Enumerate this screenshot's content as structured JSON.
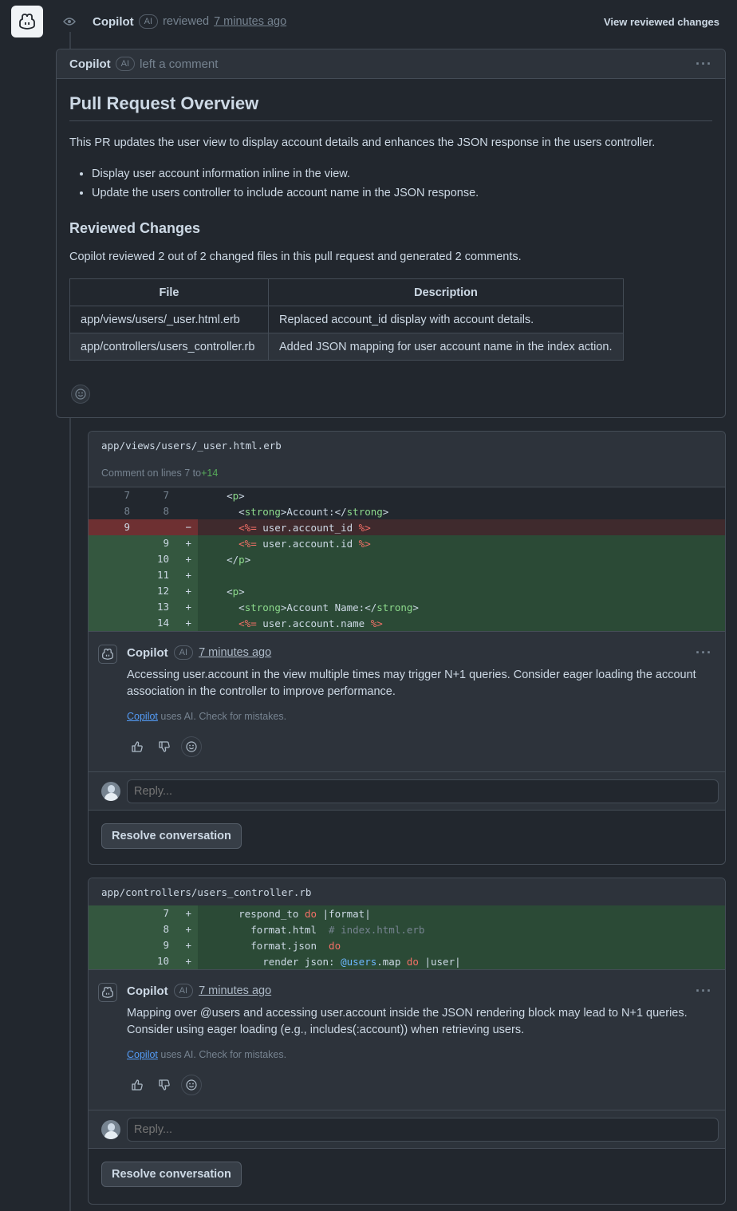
{
  "event": {
    "author": "Copilot",
    "badge": "AI",
    "action": "reviewed",
    "time": "7 minutes ago",
    "view_changes": "View reviewed changes"
  },
  "review": {
    "author": "Copilot",
    "badge": "AI",
    "action": "left a comment",
    "heading": "Pull Request Overview",
    "intro": "This PR updates the user view to display account details and enhances the JSON response in the users controller.",
    "bullets": [
      "Display user account information inline in the view.",
      "Update the users controller to include account name in the JSON response."
    ],
    "subheading": "Reviewed Changes",
    "summary": "Copilot reviewed 2 out of 2 changed files in this pull request and generated 2 comments.",
    "table": {
      "headers": [
        "File",
        "Description"
      ],
      "rows": [
        [
          "app/views/users/_user.html.erb",
          "Replaced account_id display with account details."
        ],
        [
          "app/controllers/users_controller.rb",
          "Added JSON mapping for user account name in the index action."
        ]
      ]
    }
  },
  "thread1": {
    "file": "app/views/users/_user.html.erb",
    "comment_on_prefix": "Comment on lines 7 to ",
    "comment_on_range": "+14",
    "comment": {
      "author": "Copilot",
      "badge": "AI",
      "time": "7 minutes ago",
      "text": "Accessing user.account in the view multiple times may trigger N+1 queries. Consider eager loading the account association in the controller to improve performance.",
      "disclaimer_link": "Copilot",
      "disclaimer_rest": " uses AI. Check for mistakes."
    },
    "reply_placeholder": "Reply...",
    "resolve": "Resolve conversation"
  },
  "thread2": {
    "file": "app/controllers/users_controller.rb",
    "comment": {
      "author": "Copilot",
      "badge": "AI",
      "time": "7 minutes ago",
      "text": "Mapping over @users and accessing user.account inside the JSON rendering block may lead to N+1 queries. Consider using eager loading (e.g., includes(:account)) when retrieving users.",
      "disclaimer_link": "Copilot",
      "disclaimer_rest": " uses AI. Check for mistakes."
    },
    "reply_placeholder": "Reply...",
    "resolve": "Resolve conversation"
  },
  "diff1": [
    {
      "type": "ctx",
      "old": "7",
      "new": "7",
      "sign": "",
      "parts": [
        [
          "",
          "    <"
        ],
        [
          "g",
          "p"
        ],
        [
          "",
          ">"
        ]
      ]
    },
    {
      "type": "ctx",
      "old": "8",
      "new": "8",
      "sign": "",
      "parts": [
        [
          "",
          "      <"
        ],
        [
          "g",
          "strong"
        ],
        [
          "",
          ">Account:</"
        ],
        [
          "g",
          "strong"
        ],
        [
          "",
          ">"
        ]
      ]
    },
    {
      "type": "del",
      "old": "9",
      "new": "",
      "sign": "−",
      "parts": [
        [
          "",
          "      "
        ],
        [
          "r",
          "<%="
        ],
        [
          "",
          " user.account_id "
        ],
        [
          "r",
          "%>"
        ]
      ]
    },
    {
      "type": "add",
      "old": "",
      "new": "9",
      "sign": "+",
      "parts": [
        [
          "",
          "      "
        ],
        [
          "r",
          "<%="
        ],
        [
          "",
          " user.account.id "
        ],
        [
          "r",
          "%>"
        ]
      ]
    },
    {
      "type": "add",
      "old": "",
      "new": "10",
      "sign": "+",
      "parts": [
        [
          "",
          "    </"
        ],
        [
          "g",
          "p"
        ],
        [
          "",
          ">"
        ]
      ]
    },
    {
      "type": "add",
      "old": "",
      "new": "11",
      "sign": "+",
      "parts": [
        [
          "",
          ""
        ]
      ]
    },
    {
      "type": "add",
      "old": "",
      "new": "12",
      "sign": "+",
      "parts": [
        [
          "",
          "    <"
        ],
        [
          "g",
          "p"
        ],
        [
          "",
          ">"
        ]
      ]
    },
    {
      "type": "add",
      "old": "",
      "new": "13",
      "sign": "+",
      "parts": [
        [
          "",
          "      <"
        ],
        [
          "g",
          "strong"
        ],
        [
          "",
          ">Account Name:</"
        ],
        [
          "g",
          "strong"
        ],
        [
          "",
          ">"
        ]
      ]
    },
    {
      "type": "add",
      "old": "",
      "new": "14",
      "sign": "+",
      "parts": [
        [
          "",
          "      "
        ],
        [
          "r",
          "<%="
        ],
        [
          "",
          " user.account.name "
        ],
        [
          "r",
          "%>"
        ]
      ]
    }
  ],
  "diff2": [
    {
      "type": "add",
      "old": "",
      "new": "7",
      "sign": "+",
      "parts": [
        [
          "",
          "      respond_to "
        ],
        [
          "r",
          "do"
        ],
        [
          "",
          " |format|"
        ]
      ]
    },
    {
      "type": "add",
      "old": "",
      "new": "8",
      "sign": "+",
      "parts": [
        [
          "",
          "        format.html  "
        ],
        [
          "c",
          "# index.html.erb"
        ]
      ]
    },
    {
      "type": "add",
      "old": "",
      "new": "9",
      "sign": "+",
      "parts": [
        [
          "",
          "        format.json  "
        ],
        [
          "r",
          "do"
        ]
      ]
    },
    {
      "type": "add",
      "old": "",
      "new": "10",
      "sign": "+",
      "parts": [
        [
          "",
          "          render json: "
        ],
        [
          "b",
          "@users"
        ],
        [
          "",
          ".map "
        ],
        [
          "r",
          "do"
        ],
        [
          "",
          " |user|"
        ]
      ]
    }
  ]
}
